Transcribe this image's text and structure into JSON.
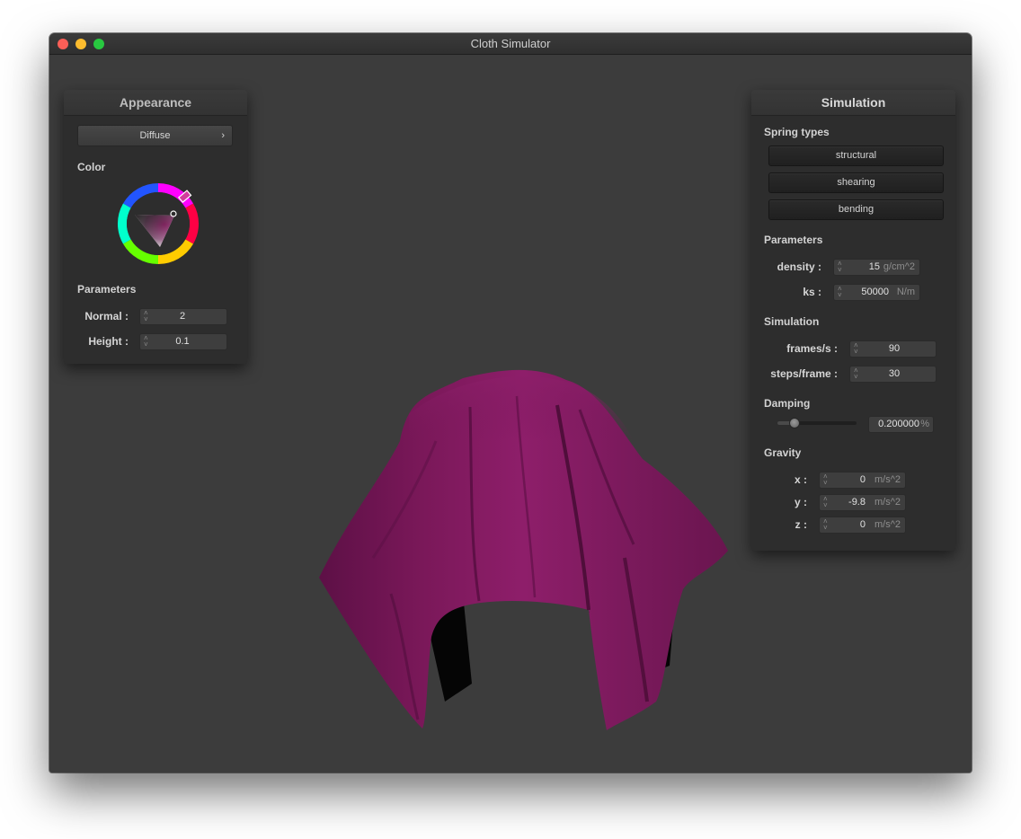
{
  "window": {
    "title": "Cloth Simulator"
  },
  "appearance": {
    "header": "Appearance",
    "shader_button": "Diffuse",
    "chevron": "›",
    "color_label": "Color",
    "color_value": "#c0298a",
    "parameters_label": "Parameters",
    "normal": {
      "label": "Normal :",
      "value": "2"
    },
    "height": {
      "label": "Height :",
      "value": "0.1"
    }
  },
  "simulation": {
    "header": "Simulation",
    "spring_types_label": "Spring types",
    "springs": [
      "structural",
      "shearing",
      "bending"
    ],
    "parameters_label": "Parameters",
    "density": {
      "label": "density :",
      "value": "15",
      "unit": "g/cm^2"
    },
    "ks": {
      "label": "ks :",
      "value": "50000",
      "unit": "N/m"
    },
    "simulation_label": "Simulation",
    "fps": {
      "label": "frames/s :",
      "value": "90"
    },
    "steps": {
      "label": "steps/frame :",
      "value": "30"
    },
    "damping_label": "Damping",
    "damping": {
      "value": "0.200000",
      "unit": "%",
      "fraction": 0.2
    },
    "gravity_label": "Gravity",
    "gx": {
      "label": "x :",
      "value": "0",
      "unit": "m/s^2"
    },
    "gy": {
      "label": "y :",
      "value": "-9.8",
      "unit": "m/s^2"
    },
    "gz": {
      "label": "z :",
      "value": "0",
      "unit": "m/s^2"
    }
  },
  "icons": {
    "spinner": "stepper-arrows-icon",
    "chevron": "chevron-right-icon"
  },
  "colors": {
    "cloth": "#8a1b66",
    "window_bg": "#3c3c3c",
    "panel_bg": "#2d2d2d"
  }
}
